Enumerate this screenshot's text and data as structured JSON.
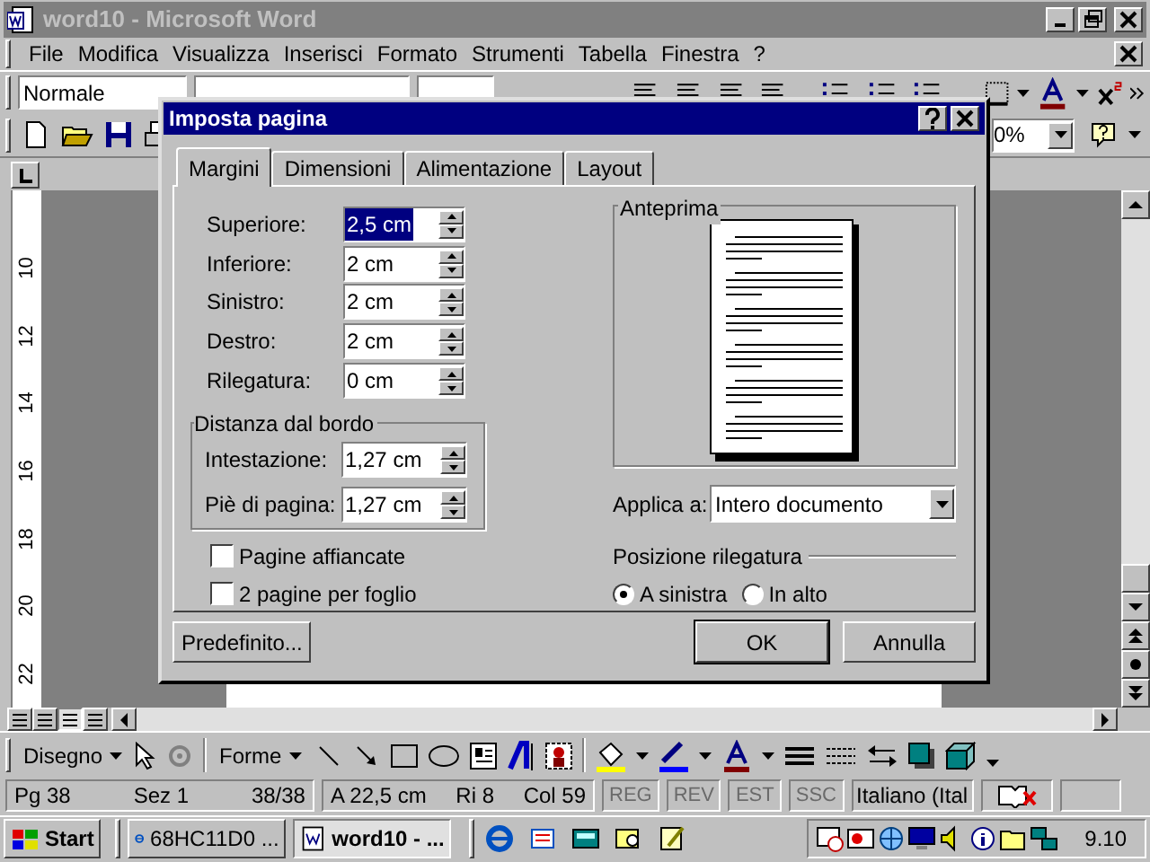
{
  "window": {
    "title": "word10 - Microsoft Word"
  },
  "menu": [
    "File",
    "Modifica",
    "Visualizza",
    "Inserisci",
    "Formato",
    "Strumenti",
    "Tabella",
    "Finestra",
    "?"
  ],
  "formatting_toolbar": {
    "style": "Normale"
  },
  "standard_toolbar": {
    "zoom": "0%"
  },
  "vertical_ruler": [
    "10",
    "12",
    "14",
    "16",
    "18",
    "20",
    "22"
  ],
  "dialog": {
    "title": "Imposta pagina",
    "tabs": [
      {
        "label": "Margini",
        "selected": true
      },
      {
        "label": "Dimensioni",
        "selected": false
      },
      {
        "label": "Alimentazione",
        "selected": false
      },
      {
        "label": "Layout",
        "selected": false
      }
    ],
    "margins": [
      {
        "label": "Superiore:",
        "value": "2,5 cm",
        "text_selected": true
      },
      {
        "label": "Inferiore:",
        "value": "2 cm",
        "text_selected": false
      },
      {
        "label": "Sinistro:",
        "value": "2 cm",
        "text_selected": false
      },
      {
        "label": "Destro:",
        "value": "2 cm",
        "text_selected": false
      },
      {
        "label": "Rilegatura:",
        "value": "0 cm",
        "text_selected": false
      }
    ],
    "edge_distance": {
      "title": "Distanza dal bordo",
      "fields": [
        {
          "label": "Intestazione:",
          "value": "1,27 cm",
          "text_selected": false
        },
        {
          "label": "Piè di pagina:",
          "value": "1,27 cm",
          "text_selected": false
        }
      ]
    },
    "checkboxes": [
      {
        "label": "Pagine affiancate",
        "checked": false
      },
      {
        "label": "2 pagine per foglio",
        "checked": false
      }
    ],
    "preview": {
      "title": "Anteprima"
    },
    "apply_to": {
      "label": "Applica a:",
      "value": "Intero documento"
    },
    "gutter_position": {
      "title": "Posizione rilegatura",
      "options": [
        {
          "label": "A sinistra",
          "selected": true
        },
        {
          "label": "In alto",
          "selected": false
        }
      ]
    },
    "buttons": [
      {
        "label": "Predefinito...",
        "default": false
      },
      {
        "label": "OK",
        "default": true
      },
      {
        "label": "Annulla",
        "default": false
      }
    ]
  },
  "drawing_toolbar": {
    "menus": [
      "Disegno",
      "Forme"
    ]
  },
  "status_bar": {
    "cells": [
      [
        "Pg 38",
        "Sez 1",
        "38/38"
      ],
      [
        "A 22,5 cm",
        "Ri 8",
        "Col 59"
      ]
    ],
    "modes": [
      {
        "label": "REG",
        "active": false
      },
      {
        "label": "REV",
        "active": false
      },
      {
        "label": "EST",
        "active": false
      },
      {
        "label": "SSC",
        "active": false
      }
    ],
    "language": "Italiano (Ital"
  },
  "taskbar": {
    "start": "Start",
    "tasks": [
      {
        "label": "68HC11D0 ...",
        "selected": false
      },
      {
        "label": "word10 - ...",
        "selected": true
      }
    ],
    "clock": "9.10"
  }
}
